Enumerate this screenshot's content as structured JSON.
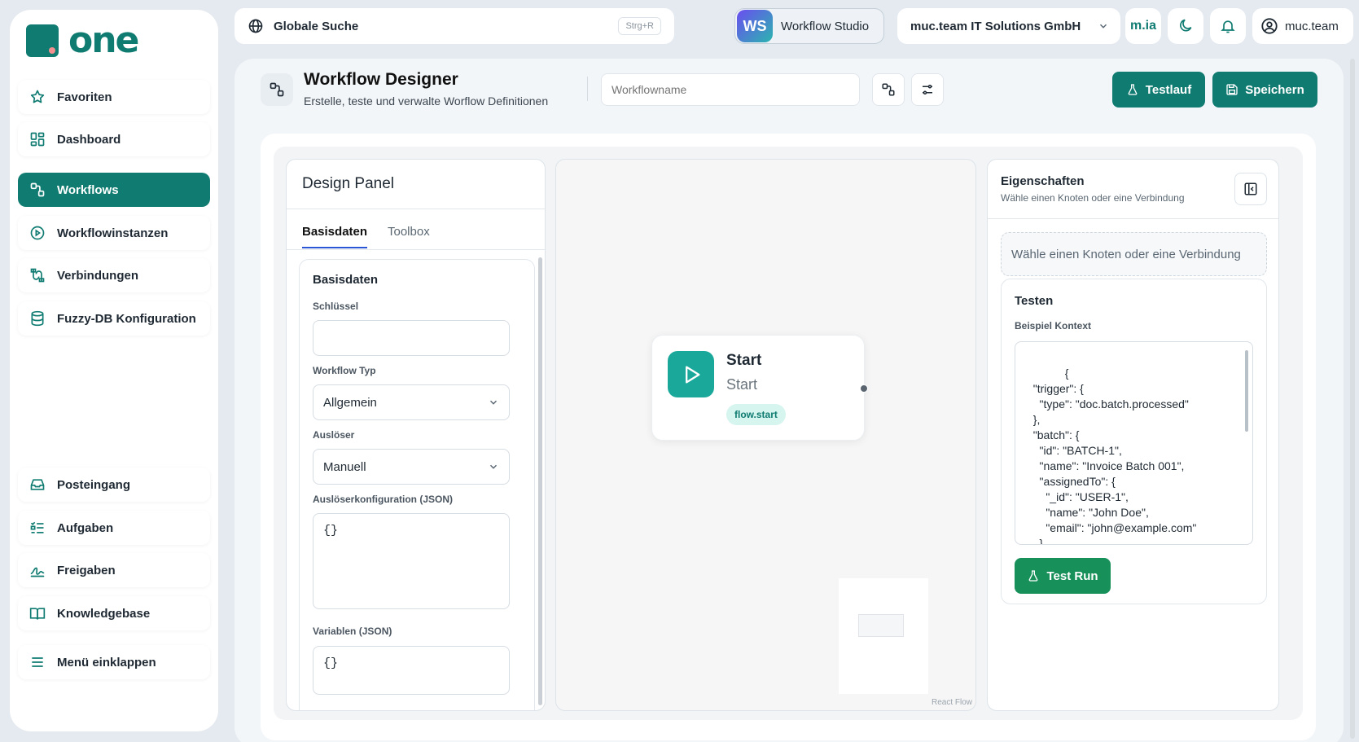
{
  "brand": {
    "logo_text": "one",
    "primary_color": "#0f7b71"
  },
  "sidebar": {
    "items": [
      {
        "label": "Favoriten",
        "icon": "star-icon"
      },
      {
        "label": "Dashboard",
        "icon": "dashboard-icon"
      },
      {
        "label": "Workflows",
        "icon": "workflow-icon",
        "active": true
      },
      {
        "label": "Workflowinstanzen",
        "icon": "play-circle-icon"
      },
      {
        "label": "Verbindungen",
        "icon": "connection-icon"
      },
      {
        "label": "Fuzzy-DB Konfiguration",
        "icon": "database-icon"
      }
    ],
    "bottom_items": [
      {
        "label": "Posteingang",
        "icon": "inbox-icon"
      },
      {
        "label": "Aufgaben",
        "icon": "tasks-icon"
      },
      {
        "label": "Freigaben",
        "icon": "signature-icon"
      },
      {
        "label": "Knowledgebase",
        "icon": "book-icon"
      },
      {
        "label": "Menü einklappen",
        "icon": "menu-icon"
      }
    ]
  },
  "topbar": {
    "search_label": "Globale Suche",
    "search_shortcut": "Strg+R",
    "studio_badge": "WS",
    "studio_label": "Workflow Studio",
    "company": "muc.team IT Solutions GmbH",
    "mia_label": "m.ia",
    "user": "muc.team"
  },
  "header": {
    "title": "Workflow Designer",
    "subtitle": "Erstelle, teste und verwalte Worflow Definitionen",
    "workflow_name_placeholder": "Workflowname",
    "test_button": "Testlauf",
    "save_button": "Speichern"
  },
  "design_panel": {
    "title": "Design Panel",
    "tabs": [
      "Basisdaten",
      "Toolbox"
    ],
    "active_tab": "Basisdaten",
    "section_title": "Basisdaten",
    "fields": {
      "key_label": "Schlüssel",
      "key_value": "",
      "type_label": "Workflow Typ",
      "type_value": "Allgemein",
      "trigger_label": "Auslöser",
      "trigger_value": "Manuell",
      "trigger_config_label": "Auslöserkonfiguration (JSON)",
      "trigger_config_value": "{}",
      "variables_label": "Variablen (JSON)",
      "variables_value": "{}"
    }
  },
  "canvas": {
    "node": {
      "title": "Start",
      "subtitle": "Start",
      "badge": "flow.start"
    },
    "attribution": "React Flow"
  },
  "properties": {
    "title": "Eigenschaften",
    "subtitle": "Wähle einen Knoten oder eine Verbindung",
    "empty_message": "Wähle einen Knoten oder eine Verbindung",
    "test_title": "Testen",
    "context_label": "Beispiel Kontext",
    "context_code": "{\n  \"trigger\": {\n    \"type\": \"doc.batch.processed\"\n  },\n  \"batch\": {\n    \"id\": \"BATCH-1\",\n    \"name\": \"Invoice Batch 001\",\n    \"assignedTo\": {\n      \"_id\": \"USER-1\",\n      \"name\": \"John Doe\",\n      \"email\": \"john@example.com\"\n    },\n    \"createdBy\": {",
    "test_button": "Test Run"
  }
}
